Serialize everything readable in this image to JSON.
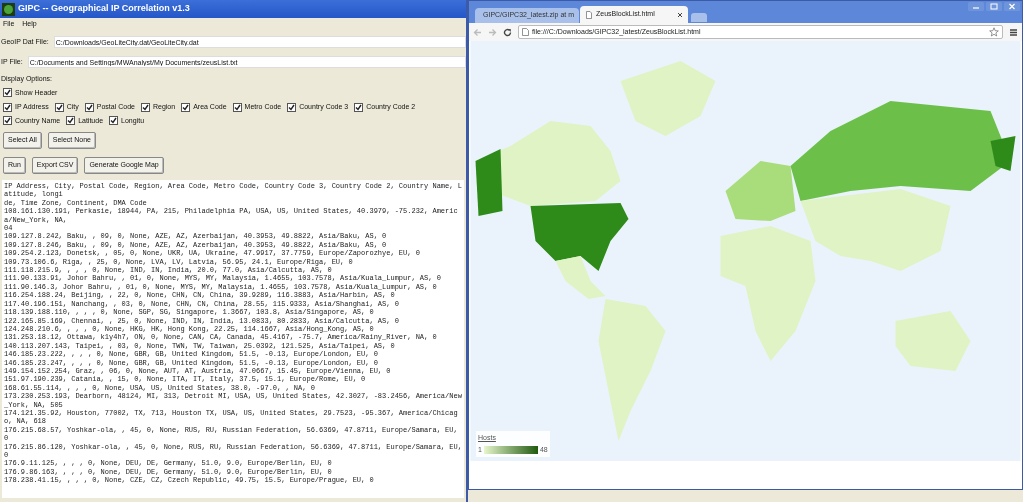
{
  "app": {
    "title": "GIPC -- Geographical IP Correlation v1.3",
    "menu": [
      "File",
      "Help"
    ],
    "geoip_field": {
      "label": "GeoIP Dat File:",
      "value": "C:/Downloads/GeoLiteCity.dat/GeoLiteCity.dat"
    },
    "ip_field": {
      "label": "IP File:",
      "value": "C:/Documents and Settings/MWAnalyst/My Documents/zeusList.txt"
    },
    "display_options_label": "Display Options:",
    "show_header": {
      "label": "Show Header",
      "checked": true
    },
    "columns": [
      {
        "label": "IP Address",
        "checked": true
      },
      {
        "label": "City",
        "checked": true
      },
      {
        "label": "Postal Code",
        "checked": true
      },
      {
        "label": "Region",
        "checked": true
      },
      {
        "label": "Area Code",
        "checked": true
      },
      {
        "label": "Metro Code",
        "checked": true
      },
      {
        "label": "Country Code 3",
        "checked": true
      },
      {
        "label": "Country Code 2",
        "checked": true
      },
      {
        "label": "Country Name",
        "checked": true
      },
      {
        "label": "Latitude",
        "checked": true
      },
      {
        "label": "Longitu",
        "checked": true
      }
    ],
    "select_buttons": [
      "Select All",
      "Select None"
    ],
    "action_buttons": [
      "Run",
      "Export CSV",
      "Generate Google Map"
    ],
    "output_lines": [
      "IP Address, City, Postal Code, Region, Area Code, Metro Code, Country Code 3, Country Code 2, Country Name, Latitude, longi",
      "de, Time Zone, Continent, DMA Code",
      "108.161.130.191, Perkasie, 18944, PA, 215, Philadelphia PA, USA, US, United States, 40.3979, -75.232, America/New_York, NA,",
      "04",
      "109.127.8.242, Baku, , 09, 0, None, AZE, AZ, Azerbaijan, 40.3953, 49.8822, Asia/Baku, AS, 0",
      "109.127.8.246, Baku, , 09, 0, None, AZE, AZ, Azerbaijan, 40.3953, 49.8822, Asia/Baku, AS, 0",
      "109.254.2.123, Donetsk, , 05, 0, None, UKR, UA, Ukraine, 47.9917, 37.7759, Europe/Zaporozhye, EU, 0",
      "109.73.106.6, Riga, , 25, 0, None, LVA, LV, Latvia, 56.95, 24.1, Europe/Riga, EU, 0",
      "111.118.215.9, , , , 0, None, IND, IN, India, 20.0, 77.0, Asia/Calcutta, AS, 0",
      "111.90.133.91, Johor Bahru, , 01, 0, None, MYS, MY, Malaysia, 1.4655, 103.7578, Asia/Kuala_Lumpur, AS, 0",
      "111.90.146.3, Johor Bahru, , 01, 0, None, MYS, MY, Malaysia, 1.4655, 103.7578, Asia/Kuala_Lumpur, AS, 0",
      "116.254.188.24, Beijing, , 22, 0, None, CHN, CN, China, 39.9289, 116.3883, Asia/Harbin, AS, 0",
      "117.40.196.151, Nanchang, , 03, 0, None, CHN, CN, China, 28.55, 115.9333, Asia/Shanghai, AS, 0",
      "118.139.188.110, , , , 0, None, SGP, SG, Singapore, 1.3667, 103.8, Asia/Singapore, AS, 0",
      "122.165.85.169, Chennai, , 25, 0, None, IND, IN, India, 13.0833, 80.2833, Asia/Calcutta, AS, 0",
      "124.248.210.6, , , , 0, None, HKG, HK, Hong Kong, 22.25, 114.1667, Asia/Hong_Kong, AS, 0",
      "131.253.18.12, Ottawa, k1y4h7, ON, 0, None, CAN, CA, Canada, 45.4167, -75.7, America/Rainy_River, NA, 0",
      "140.113.207.143, Taipei, , 03, 0, None, TWN, TW, Taiwan, 25.0392, 121.525, Asia/Taipei, AS, 0",
      "146.185.23.222, , , , 0, None, GBR, GB, United Kingdom, 51.5, -0.13, Europe/London, EU, 0",
      "146.185.23.247, , , , 0, None, GBR, GB, United Kingdom, 51.5, -0.13, Europe/London, EU, 0",
      "149.154.152.254, Graz, , 06, 0, None, AUT, AT, Austria, 47.0667, 15.45, Europe/Vienna, EU, 0",
      "151.97.190.239, Catania, , 15, 0, None, ITA, IT, Italy, 37.5, 15.1, Europe/Rome, EU, 0",
      "168.61.55.114, , , , 0, None, USA, US, United States, 38.0, -97.0, , NA, 0",
      "173.230.253.193, Dearborn, 48124, MI, 313, Detroit MI, USA, US, United States, 42.3027, -83.2456, America/New_York, NA, 505",
      "174.121.35.92, Houston, 77002, TX, 713, Houston TX, USA, US, United States, 29.7523, -95.367, America/Chicago, NA, 618",
      "176.215.68.57, Yoshkar-ola, , 45, 0, None, RUS, RU, Russian Federation, 56.6369, 47.8711, Europe/Samara, EU, 0",
      "176.215.86.120, Yoshkar-ola, , 45, 0, None, RUS, RU, Russian Federation, 56.6369, 47.8711, Europe/Samara, EU, 0",
      "176.9.11.125, , , , 0, None, DEU, DE, Germany, 51.0, 9.0, Europe/Berlin, EU, 0",
      "176.9.86.163, , , , 0, None, DEU, DE, Germany, 51.0, 9.0, Europe/Berlin, EU, 0",
      "178.238.41.15, , , , 0, None, CZE, CZ, Czech Republic, 49.75, 15.5, Europe/Prague, EU, 0"
    ]
  },
  "browser": {
    "tabs": [
      {
        "label": "GIPC/GIPC32_latest.zip at m",
        "selected": false
      },
      {
        "label": "ZeusBlockList.html",
        "selected": true
      }
    ],
    "address": "file:///C:/Downloads/GIPC32_latest/ZeusBlockList.html",
    "legend": {
      "title": "Hosts",
      "min": "1",
      "max": "48"
    }
  }
}
